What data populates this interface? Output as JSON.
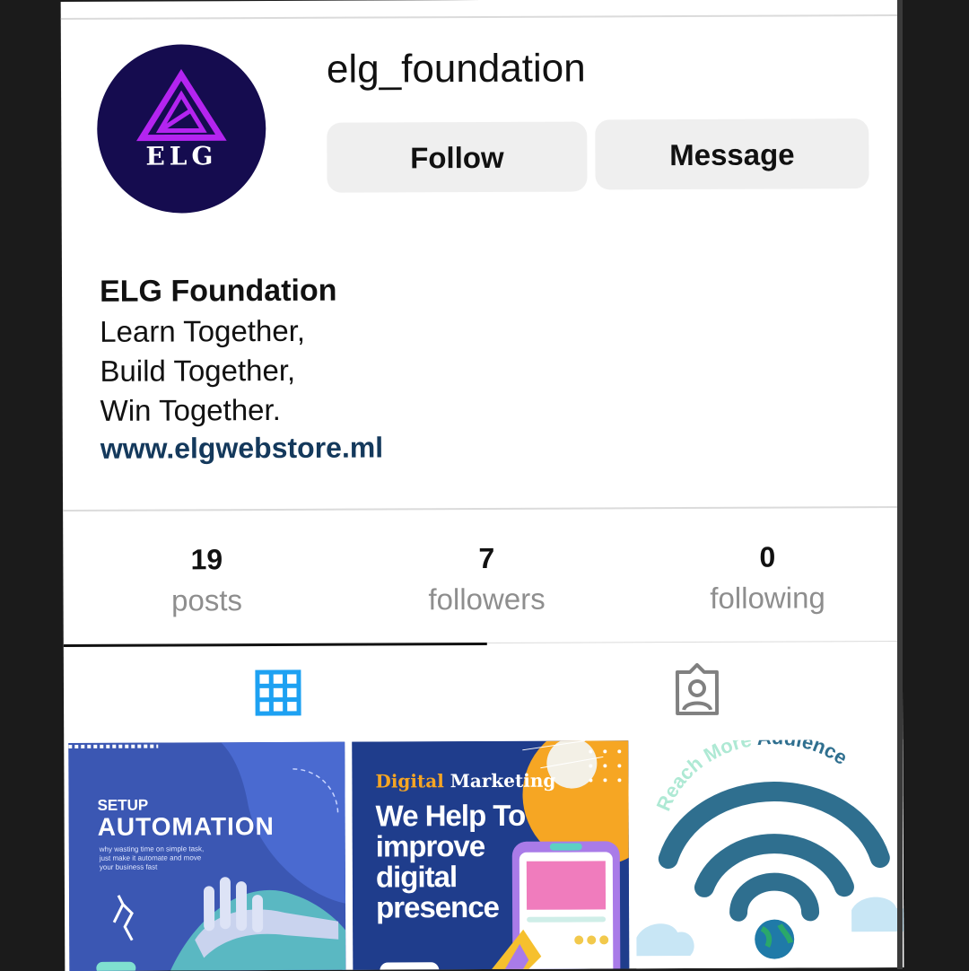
{
  "profile": {
    "username": "elg_foundation",
    "avatar_text": "ELG",
    "follow_label": "Follow",
    "message_label": "Message"
  },
  "bio": {
    "name": "ELG Foundation",
    "lines": [
      "Learn Together,",
      "Build Together,",
      "Win Together."
    ],
    "link": "www.elgwebstore.ml"
  },
  "stats": [
    {
      "value": "19",
      "label": "posts"
    },
    {
      "value": "7",
      "label": "followers"
    },
    {
      "value": "0",
      "label": "following"
    }
  ],
  "tabs": [
    {
      "name": "grid",
      "icon": "grid-icon",
      "active": true,
      "color": "#1da1f2"
    },
    {
      "name": "tagged",
      "icon": "tagged-user-icon",
      "active": false,
      "color": "#8e8e8e"
    }
  ],
  "posts": [
    {
      "small": "SETUP",
      "big": "AUTOMATION",
      "body": "why wasting time on simple task, just make it automate and move your business fast"
    },
    {
      "head_a": "Digital",
      "head_b": "Marketing",
      "big": "We Help To improve digital presence"
    },
    {
      "arc_a": "Reach More",
      "arc_b": "Audience"
    }
  ],
  "colors": {
    "avatar_bg": "#150c4f",
    "logo": "#b424f0",
    "link": "#14395c",
    "button_bg": "#efefef"
  }
}
